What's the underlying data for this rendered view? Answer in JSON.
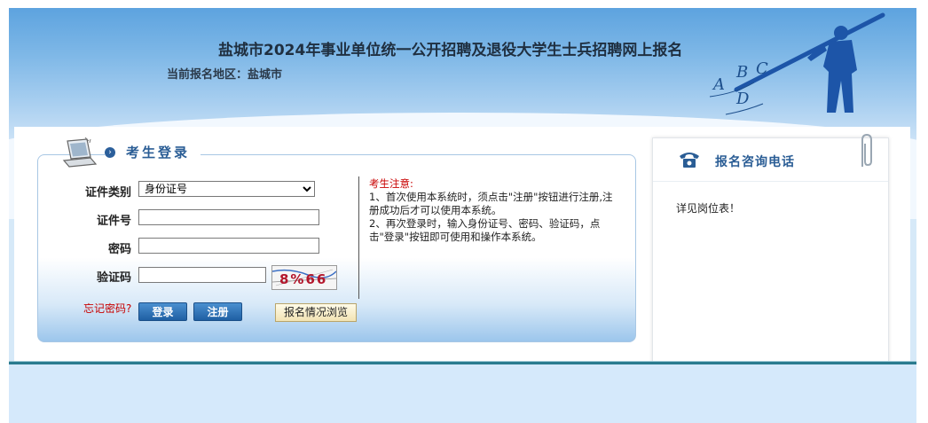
{
  "header": {
    "title": "盐城市2024年事业单位统一公开招聘及退役大学生士兵招聘网上报名",
    "region_label": "当前报名地区：盐城市",
    "deco_letters": [
      "A",
      "B",
      "C",
      "D"
    ]
  },
  "login": {
    "section_title": "考生登录",
    "fields": {
      "id_type_label": "证件类别",
      "id_type_selected": "身份证号",
      "id_number_label": "证件号",
      "password_label": "密码",
      "captcha_label": "验证码"
    },
    "captcha_text": "8%66",
    "forgot_label": "忘记密码?",
    "login_button": "登录",
    "register_button": "注册",
    "browse_button": "报名情况浏览"
  },
  "notice": {
    "title": "考生注意:",
    "line1": "1、首次使用本系统时，须点击\"注册\"按钮进行注册,注册成功后才可以使用本系统。",
    "line2": "2、再次登录时，输入身份证号、密码、验证码，点击\"登录\"按钮即可使用和操作本系统。"
  },
  "contact": {
    "title": "报名咨询电话",
    "body": "详见岗位表！"
  },
  "colors": {
    "accent": "#2a5d95",
    "warning": "#c80000",
    "header_blue": "#5da3df"
  }
}
